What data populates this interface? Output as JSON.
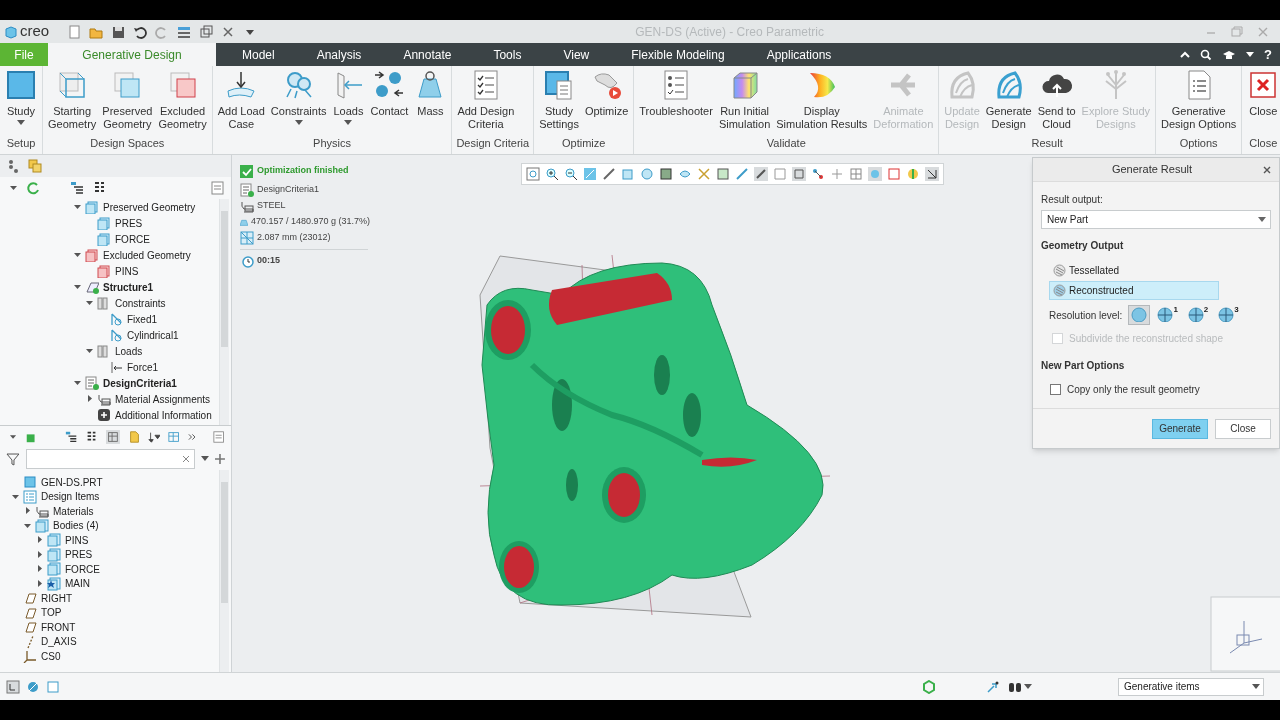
{
  "window": {
    "logo": "creo",
    "title": "GEN-DS (Active) - Creo Parametric",
    "help_label": "?"
  },
  "menu_tabs": [
    {
      "label": "File",
      "kind": "file",
      "selected": false
    },
    {
      "label": "Generative Design",
      "kind": "tab",
      "selected": true
    },
    {
      "label": "Model",
      "kind": "tab",
      "selected": false
    },
    {
      "label": "Analysis",
      "kind": "tab",
      "selected": false
    },
    {
      "label": "Annotate",
      "kind": "tab",
      "selected": false
    },
    {
      "label": "Tools",
      "kind": "tab",
      "selected": false
    },
    {
      "label": "View",
      "kind": "tab",
      "selected": false
    },
    {
      "label": "Flexible Modeling",
      "kind": "tab",
      "selected": false
    },
    {
      "label": "Applications",
      "kind": "tab",
      "selected": false
    }
  ],
  "ribbon": {
    "groups": [
      {
        "label": "Setup",
        "buttons": [
          {
            "label": "Study",
            "disabled": false,
            "dropdown": true
          }
        ]
      },
      {
        "label": "Design Spaces",
        "buttons": [
          {
            "label": "Starting\nGeometry",
            "disabled": false,
            "dropdown": false
          },
          {
            "label": "Preserved\nGeometry",
            "disabled": false,
            "dropdown": false
          },
          {
            "label": "Excluded\nGeometry",
            "disabled": false,
            "dropdown": false
          }
        ]
      },
      {
        "label": "Physics",
        "buttons": [
          {
            "label": "Add Load\nCase",
            "disabled": false,
            "dropdown": false
          },
          {
            "label": "Constraints",
            "disabled": false,
            "dropdown": true
          },
          {
            "label": "Loads",
            "disabled": false,
            "dropdown": true
          },
          {
            "label": "Contact",
            "disabled": false,
            "dropdown": false
          },
          {
            "label": "Mass",
            "disabled": false,
            "dropdown": false
          }
        ]
      },
      {
        "label": "Design Criteria",
        "buttons": [
          {
            "label": "Add Design\nCriteria",
            "disabled": false,
            "dropdown": false
          }
        ]
      },
      {
        "label": "Optimize",
        "buttons": [
          {
            "label": "Study\nSettings",
            "disabled": false,
            "dropdown": false
          },
          {
            "label": "Optimize",
            "disabled": false,
            "dropdown": false
          }
        ]
      },
      {
        "label": "Validate",
        "buttons": [
          {
            "label": "Troubleshooter",
            "disabled": false,
            "dropdown": false
          },
          {
            "label": "Run Initial\nSimulation",
            "disabled": false,
            "dropdown": false
          },
          {
            "label": "Display\nSimulation Results",
            "disabled": false,
            "dropdown": false
          },
          {
            "label": "Animate\nDeformation",
            "disabled": true,
            "dropdown": false
          }
        ]
      },
      {
        "label": "Result",
        "buttons": [
          {
            "label": "Update\nDesign",
            "disabled": true,
            "dropdown": false
          },
          {
            "label": "Generate\nDesign",
            "disabled": false,
            "dropdown": false
          },
          {
            "label": "Send to\nCloud",
            "disabled": false,
            "dropdown": false
          },
          {
            "label": "Explore Study\nDesigns",
            "disabled": true,
            "dropdown": false
          }
        ]
      },
      {
        "label": "Options",
        "buttons": [
          {
            "label": "Generative\nDesign Options",
            "disabled": false,
            "dropdown": false
          }
        ]
      },
      {
        "label": "Close",
        "buttons": [
          {
            "label": "Close",
            "disabled": false,
            "dropdown": false
          }
        ]
      }
    ]
  },
  "study_tree": {
    "items": [
      {
        "label": "Preserved Geometry",
        "kind": "preserved",
        "expanded": true,
        "children": [
          {
            "label": "PRES",
            "kind": "preserved"
          },
          {
            "label": "FORCE",
            "kind": "preserved"
          }
        ]
      },
      {
        "label": "Excluded Geometry",
        "kind": "excluded",
        "expanded": true,
        "children": [
          {
            "label": "PINS",
            "kind": "excluded"
          }
        ]
      },
      {
        "label": "Structure1",
        "kind": "study",
        "expanded": true,
        "children": [
          {
            "label": "Constraints",
            "kind": "folder",
            "expanded": true,
            "children": [
              {
                "label": "Fixed1",
                "kind": "constraint"
              },
              {
                "label": "Cylindrical1",
                "kind": "constraint"
              }
            ]
          },
          {
            "label": "Loads",
            "kind": "folder",
            "expanded": true,
            "children": [
              {
                "label": "Force1",
                "kind": "load"
              }
            ]
          }
        ]
      },
      {
        "label": "DesignCriteria1",
        "kind": "criteria",
        "expanded": true,
        "children": [
          {
            "label": "Material Assignments",
            "kind": "material",
            "expanded": false
          },
          {
            "label": "Additional Information",
            "kind": "info"
          }
        ]
      }
    ]
  },
  "model_tree": {
    "items": [
      {
        "label": "GEN-DS.PRT",
        "kind": "part"
      },
      {
        "label": "Design Items",
        "kind": "list",
        "expanded": true,
        "children": [
          {
            "label": "Materials",
            "kind": "material",
            "expanded": false
          },
          {
            "label": "Bodies (4)",
            "kind": "body",
            "expanded": true,
            "children": [
              {
                "label": "PINS",
                "kind": "body",
                "expanded": false
              },
              {
                "label": "PRES",
                "kind": "body",
                "expanded": false
              },
              {
                "label": "FORCE",
                "kind": "body",
                "expanded": false
              },
              {
                "label": "MAIN",
                "kind": "main",
                "expanded": false
              }
            ]
          }
        ]
      },
      {
        "label": "RIGHT",
        "kind": "plane"
      },
      {
        "label": "TOP",
        "kind": "plane"
      },
      {
        "label": "FRONT",
        "kind": "plane"
      },
      {
        "label": "D_AXIS",
        "kind": "axis"
      },
      {
        "label": "CS0",
        "kind": "csys"
      }
    ]
  },
  "study_info": {
    "status": "Optimization finished",
    "items": [
      {
        "kind": "criteria",
        "text": "DesignCriteria1"
      },
      {
        "kind": "material",
        "text": "STEEL"
      },
      {
        "kind": "mass",
        "text": "470.157 / 1480.970 g (31.7%)"
      },
      {
        "kind": "mesh",
        "text": "2.087 mm (23012)"
      },
      {
        "kind": "time",
        "text": "00:15"
      }
    ]
  },
  "dialog": {
    "title": "Generate Result",
    "result_output_label": "Result output:",
    "result_output": "New Part",
    "geometry_output_heading": "Geometry Output",
    "geometry_options": [
      {
        "label": "Tessellated",
        "selected": false
      },
      {
        "label": "Reconstructed",
        "selected": true
      }
    ],
    "resolution_label": "Resolution level:",
    "resolution_levels": [
      {
        "selected": true
      },
      {
        "label": "1",
        "selected": false
      },
      {
        "label": "2",
        "selected": false
      },
      {
        "label": "3",
        "selected": false
      }
    ],
    "subdivide": {
      "label": "Subdivide the reconstructed shape",
      "checked": false,
      "disabled": true
    },
    "new_part_heading": "New Part Options",
    "copy_only": {
      "label": "Copy only the result geometry",
      "checked": false,
      "disabled": false
    },
    "buttons": [
      {
        "label": "Generate",
        "kind": "primary"
      },
      {
        "label": "Close",
        "kind": "secondary"
      }
    ]
  },
  "status_bar": {
    "filter": "Generative items"
  }
}
